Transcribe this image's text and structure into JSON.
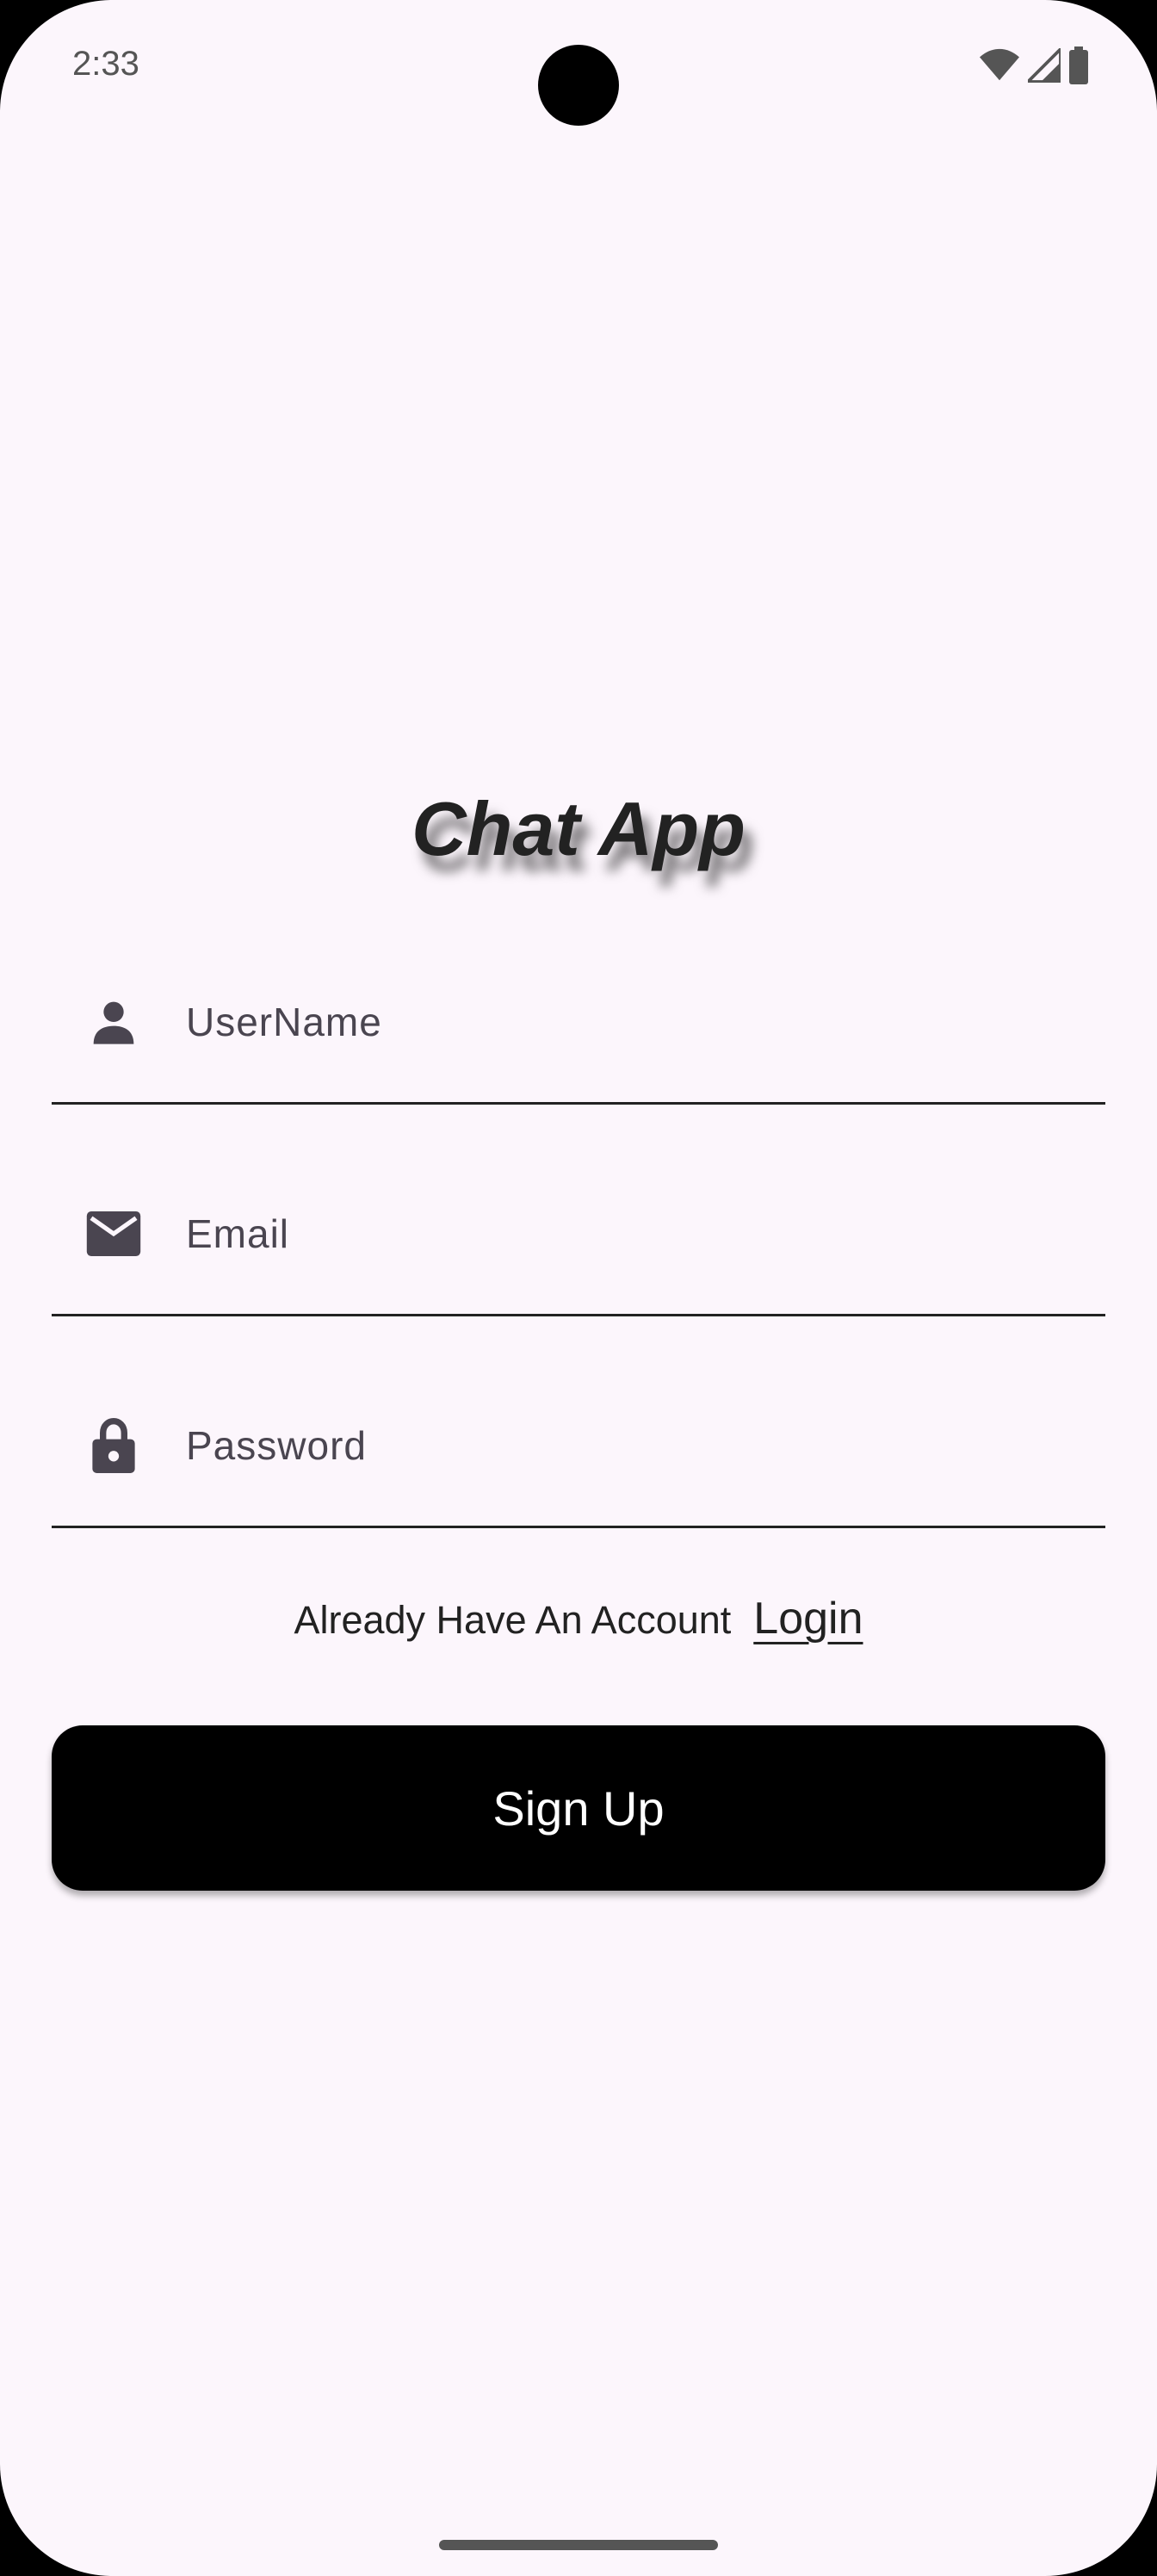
{
  "status_bar": {
    "time": "2:33",
    "icons": [
      "wifi-icon",
      "signal-icon",
      "battery-icon"
    ]
  },
  "app": {
    "title": "Chat App"
  },
  "form": {
    "username": {
      "icon": "person-icon",
      "placeholder": "UserName",
      "value": ""
    },
    "email": {
      "icon": "mail-icon",
      "placeholder": "Email",
      "value": ""
    },
    "password": {
      "icon": "lock-icon",
      "placeholder": "Password",
      "value": ""
    }
  },
  "account_prompt": {
    "text": "Already Have An Account",
    "login_label": "Login"
  },
  "signup": {
    "label": "Sign Up"
  },
  "colors": {
    "background": "#fcf6fc",
    "button": "#000000",
    "text": "#222222",
    "icon": "#4a4550"
  }
}
